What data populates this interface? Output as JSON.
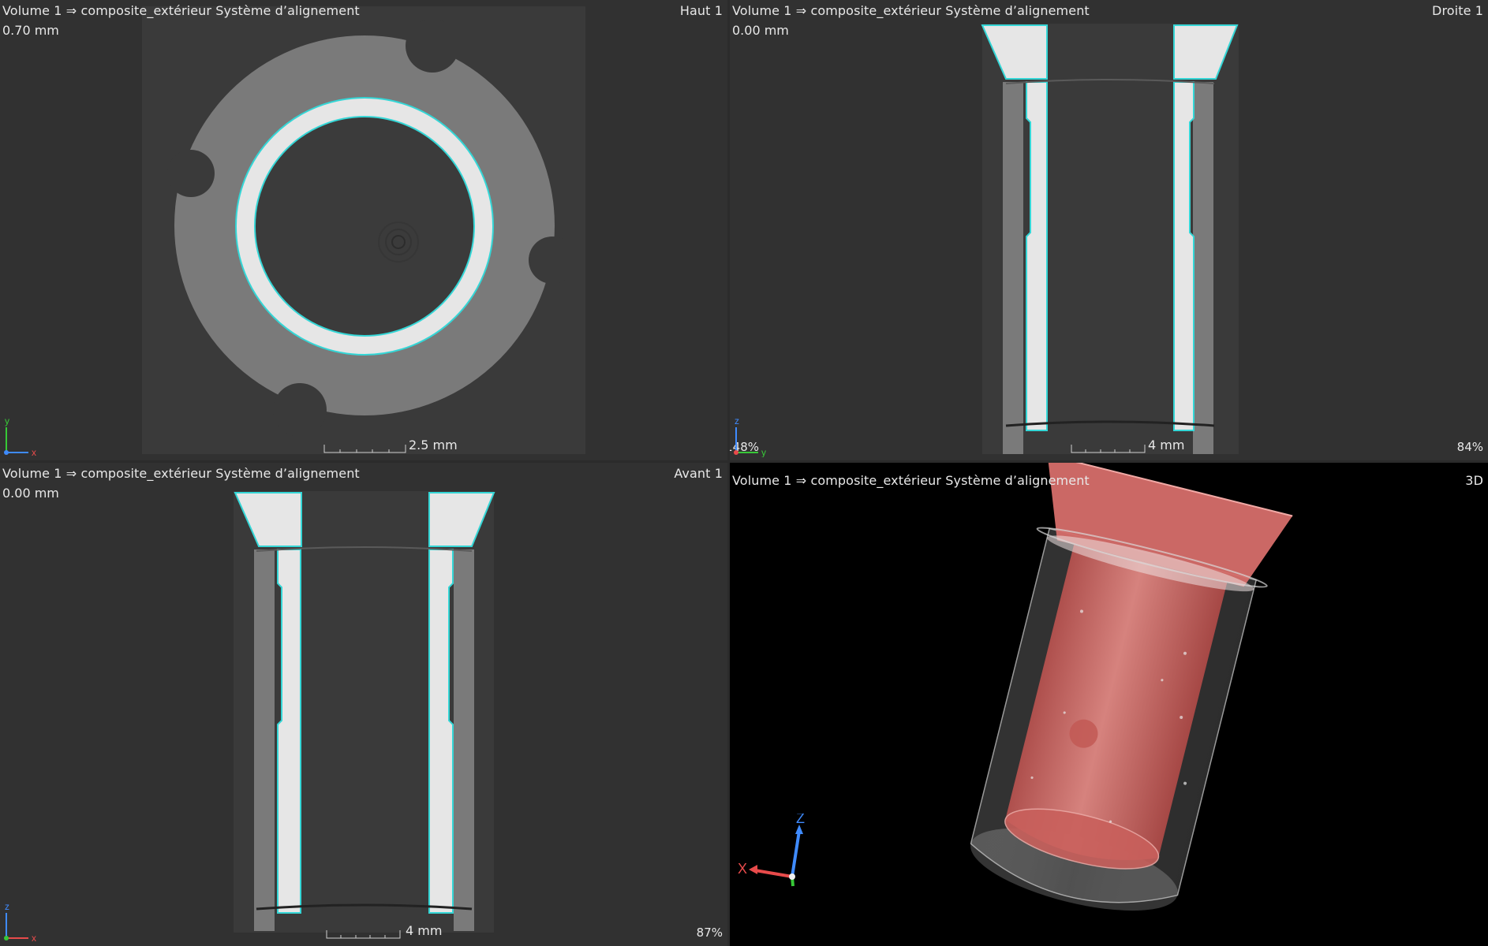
{
  "viewports": {
    "top_left": {
      "title": "Volume 1 ⇒ composite_extérieur Système d’alignement",
      "view_name": "Haut 1",
      "slice_position": "0.70 mm",
      "scale_label": "2.5 mm",
      "axis_h": "x",
      "axis_v": "y"
    },
    "top_right": {
      "title": "Volume 1 ⇒ composite_extérieur Système d’alignement",
      "view_name": "Droite 1",
      "slice_position": "0.00 mm",
      "scale_label": "4 mm",
      "zoom_left": "148%",
      "zoom_right": "84%",
      "axis_h": "y",
      "axis_v": "z"
    },
    "bottom_left": {
      "title": "Volume 1 ⇒ composite_extérieur Système d’alignement",
      "view_name": "Avant 1",
      "slice_position": "0.00 mm",
      "scale_label": "4 mm",
      "zoom": "87%",
      "axis_h": "x",
      "axis_v": "z"
    },
    "bottom_right": {
      "title": "Volume 1 ⇒ composite_extérieur Système d’alignement",
      "view_name": "3D",
      "axis_x": "X",
      "axis_z": "Z"
    }
  },
  "colors": {
    "panel_bg": "#313131",
    "surface_outline": "#34d6d6",
    "bright_material": "#e7e7e7",
    "gray_material": "#7d7d7d",
    "mesh_pink": "#d9706c",
    "axis_red": "#e84b4b",
    "axis_green": "#37c837",
    "axis_blue": "#3f8bff"
  },
  "icons": {
    "axis_gizmo_2d": "axis-triad-icon",
    "axis_gizmo_3d": "axis-triad-3d-icon"
  }
}
